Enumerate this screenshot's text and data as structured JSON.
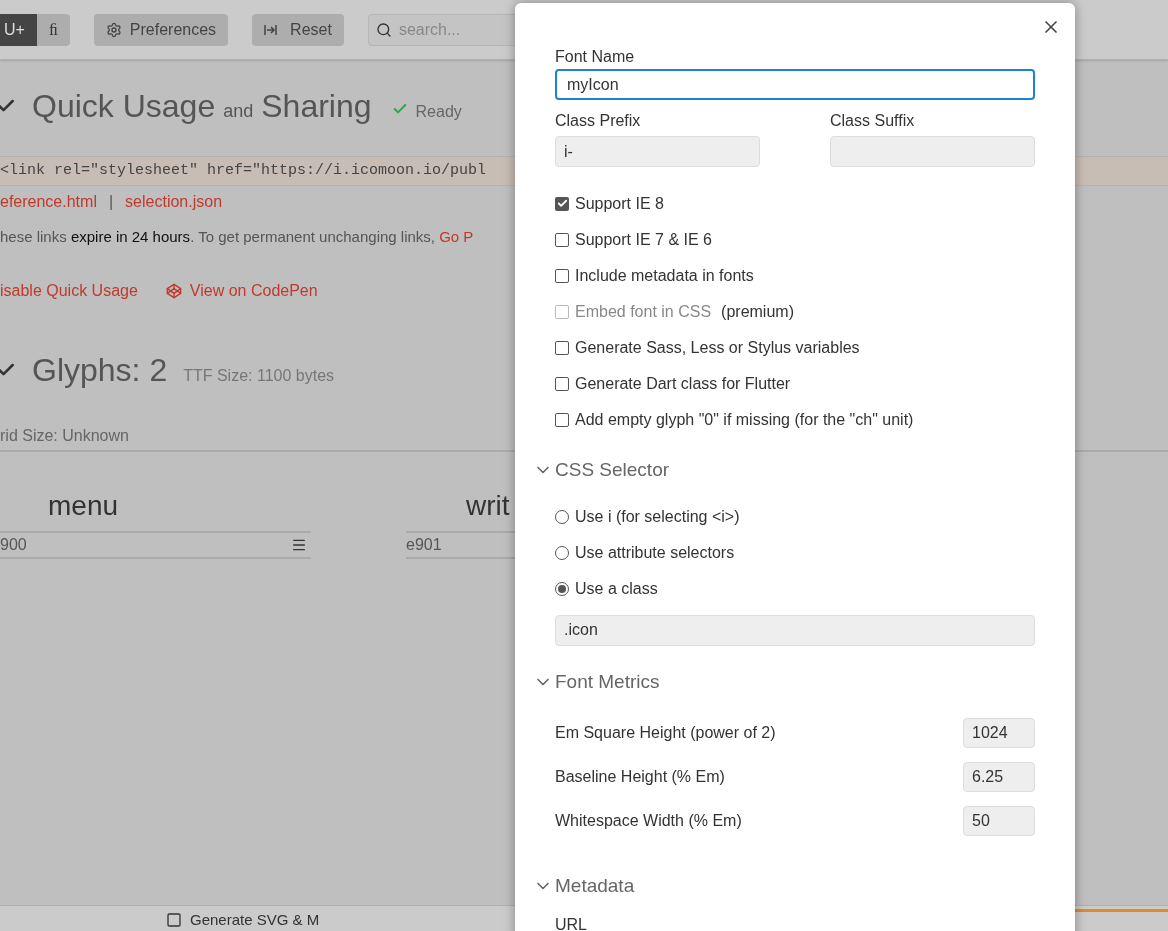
{
  "toolbar": {
    "modes": [
      {
        "label": "U+",
        "selected": true
      },
      {
        "label": "ﬁ",
        "selected": false
      }
    ],
    "preferences": "Preferences",
    "reset": "Reset",
    "search_placeholder": "search..."
  },
  "quick_usage": {
    "title": "Quick Usage",
    "connector": "and",
    "title_end": "Sharing",
    "status": "Ready",
    "code": "<link rel=\"stylesheet\" href=\"https://i.icomoon.io/publ",
    "links": [
      "eference.html",
      "selection.json"
    ],
    "separator": "|",
    "note": "hese links **expire in 24 hours**. To get permanent unchanging links,",
    "note_link": "Go P",
    "disable": "isable Quick Usage",
    "codepen": "View on CodePen"
  },
  "glyphs": {
    "title": "Glyphs: 2",
    "ttf_size": "TTF Size: 1100 bytes",
    "grid_size": "rid Size: Unknown",
    "items": [
      {
        "name": "menu",
        "code": "900",
        "kind": "menu"
      },
      {
        "name": "writ",
        "code": "e901",
        "kind": "none"
      }
    ]
  },
  "bottom_bar": {
    "label": "Generate SVG & M"
  },
  "dialog": {
    "font_name": {
      "label": "Font Name",
      "value": "myIcon"
    },
    "class_prefix": {
      "label": "Class Prefix",
      "value": "i-"
    },
    "class_suffix": {
      "label": "Class Suffix"
    },
    "options": [
      {
        "label": "Support IE 8",
        "checked": true,
        "disabled": false
      },
      {
        "label": "Support IE 7 & IE 6",
        "checked": false,
        "disabled": false
      },
      {
        "label": "Include metadata in fonts",
        "checked": false,
        "disabled": false
      },
      {
        "label": "Embed font in CSS",
        "note": "(premium)",
        "checked": false,
        "disabled": true
      },
      {
        "label": "Generate Sass, Less or Stylus variables",
        "checked": false,
        "disabled": false
      },
      {
        "label": "Generate Dart class for Flutter",
        "checked": false,
        "disabled": false
      },
      {
        "label": "Add empty glyph \"0\" if missing (for the \"ch\" unit)",
        "checked": false,
        "disabled": false
      }
    ],
    "css_selector": {
      "title": "CSS Selector",
      "expanded": true,
      "choices": [
        {
          "label": "Use i (for selecting <i>)",
          "selected": false
        },
        {
          "label": "Use attribute selectors",
          "selected": false
        },
        {
          "label": "Use a class",
          "selected": true
        }
      ],
      "class_value": ".icon"
    },
    "font_metrics": {
      "title": "Font Metrics",
      "expanded": true,
      "rows": [
        {
          "label": "Em Square Height (power of 2)",
          "value": "1024"
        },
        {
          "label": "Baseline Height (% Em)",
          "value": "6.25"
        },
        {
          "label": "Whitespace Width (% Em)",
          "value": "50"
        }
      ]
    },
    "metadata": {
      "title": "Metadata",
      "expanded": true,
      "first_label": "URL"
    }
  }
}
